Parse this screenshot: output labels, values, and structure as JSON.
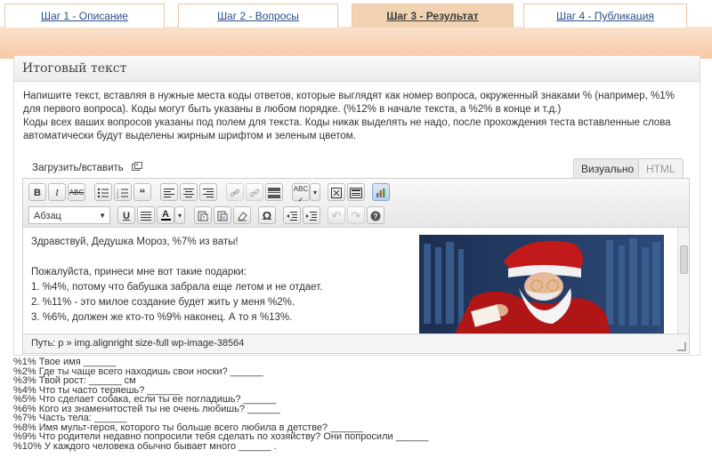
{
  "tabs": [
    {
      "label": "Шаг 1 - Описание",
      "active": false
    },
    {
      "label": "Шаг 2 - Вопросы",
      "active": false
    },
    {
      "label": "Шаг 3 - Результат",
      "active": true
    },
    {
      "label": "Шаг 4 - Публикация",
      "active": false
    }
  ],
  "panel": {
    "title": "Итоговый текст",
    "instructions": [
      "Напишите текст, вставляя в нужные места коды ответов, которые выглядят как номер вопроса, окруженный знаками % (например, %1% для первого вопроса). Коды могут быть указаны в любом порядке. (%12% в начале текста, а %2% в конце и т.д.)",
      "Коды всех ваших вопросов указаны под полем для текста. Коды никак выделять не надо, после прохождения теста вставленные слова автоматически будут выделены жирным шрифтом и зеленым цветом."
    ],
    "upload_label": "Загрузить/вставить",
    "mode_tabs": {
      "visual": "Визуально",
      "html": "HTML"
    }
  },
  "editor": {
    "format_select": "Абзац",
    "content_lines": [
      "Здравствуй, Дедушка Мороз, %7% из ваты!",
      "",
      "Пожалуйста, принеси мне вот такие подарки:",
      "1. %4%, потому что бабушка забрала еще летом и не отдает.",
      "2. %11% - это милое создание будет жить у меня %2%.",
      "3. %6%, должен же кто-то %9% наконец. А то я %13%."
    ],
    "path_label": "Путь: p » img.alignright size-full wp-image-38564"
  },
  "codes": [
    "%1% Твое имя ______",
    "%2% Где ты чаще всего находишь свои носки? ______",
    "%3% Твой рост: ______ см",
    "%4% Что ты часто теряешь? ______",
    "%5% Что сделает собака, если ты ее погладишь? ______",
    "%6% Кого из знаменитостей ты не очень любишь? ______",
    "%7% Часть тела: ______",
    "%8% Имя мульт-героя, которого ты больше всего любила в детстве? ______",
    "%9% Что родители недавно попросили тебя сделать по хозяйству? Они попросили ______",
    "%10% У каждого человека обычно бывает много ______ ."
  ]
}
